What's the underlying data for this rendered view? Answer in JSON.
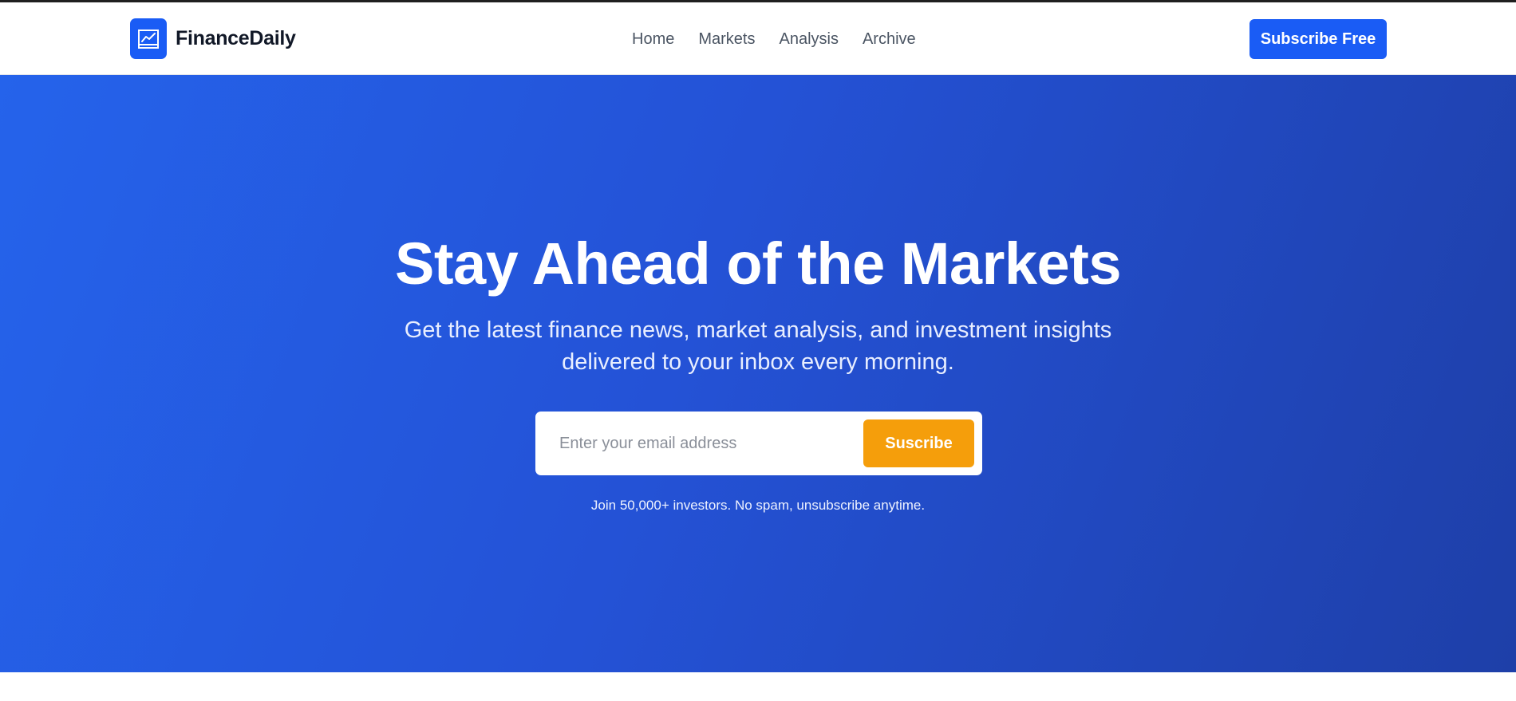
{
  "brand": {
    "name": "FinanceDaily",
    "logo_icon": "trend-chart-icon"
  },
  "nav": {
    "links": [
      "Home",
      "Markets",
      "Analysis",
      "Archive"
    ],
    "cta_label": "Subscribe Free"
  },
  "hero": {
    "title": "Stay Ahead of the Markets",
    "subtitle": "Get the latest finance news, market analysis, and investment insights delivered to your inbox every morning.",
    "form": {
      "email_placeholder": "Enter your email address",
      "email_value": "",
      "submit_label": "Suscribe"
    },
    "note": "Join 50,000+ investors. No spam, unsubscribe anytime."
  },
  "colors": {
    "primary": "#1a5cf5",
    "accent": "#f59e0b",
    "hero_gradient_start": "#2563eb",
    "hero_gradient_end": "#1e3fa8"
  }
}
